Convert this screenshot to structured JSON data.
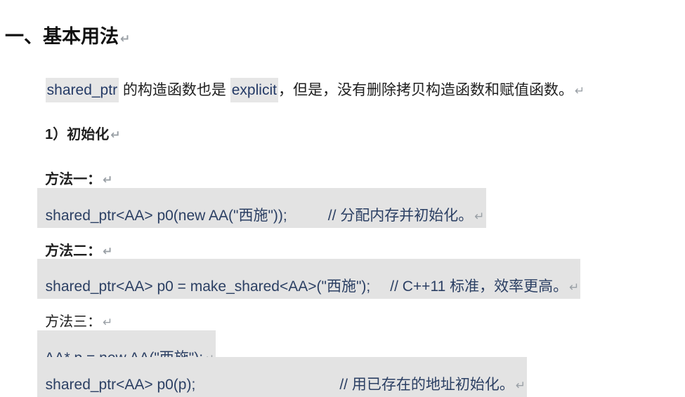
{
  "heading": "一、基本用法",
  "intro": {
    "term1": "shared_ptr",
    "text1": " 的构造函数也是 ",
    "term2": "explicit",
    "text2": "，但是，没有删除拷贝构造函数和赋值函数。"
  },
  "section": "1）初始化",
  "methods": [
    {
      "label": "方法一：",
      "code": "shared_ptr<AA> p0(new AA(\"西施\"));",
      "comment": "// 分配内存并初始化。"
    },
    {
      "label": "方法二：",
      "code": "shared_ptr<AA> p0 = make_shared<AA>(\"西施\");",
      "comment": "// C++11 标准，效率更高。"
    },
    {
      "label": "方法三：",
      "code": "AA* p = new AA(\"西施\");",
      "code2": "shared_ptr<AA> p0(p);",
      "comment": "// 用已存在的地址初始化。"
    }
  ],
  "paragraph_mark": "↵",
  "cursor_glyph": "I"
}
